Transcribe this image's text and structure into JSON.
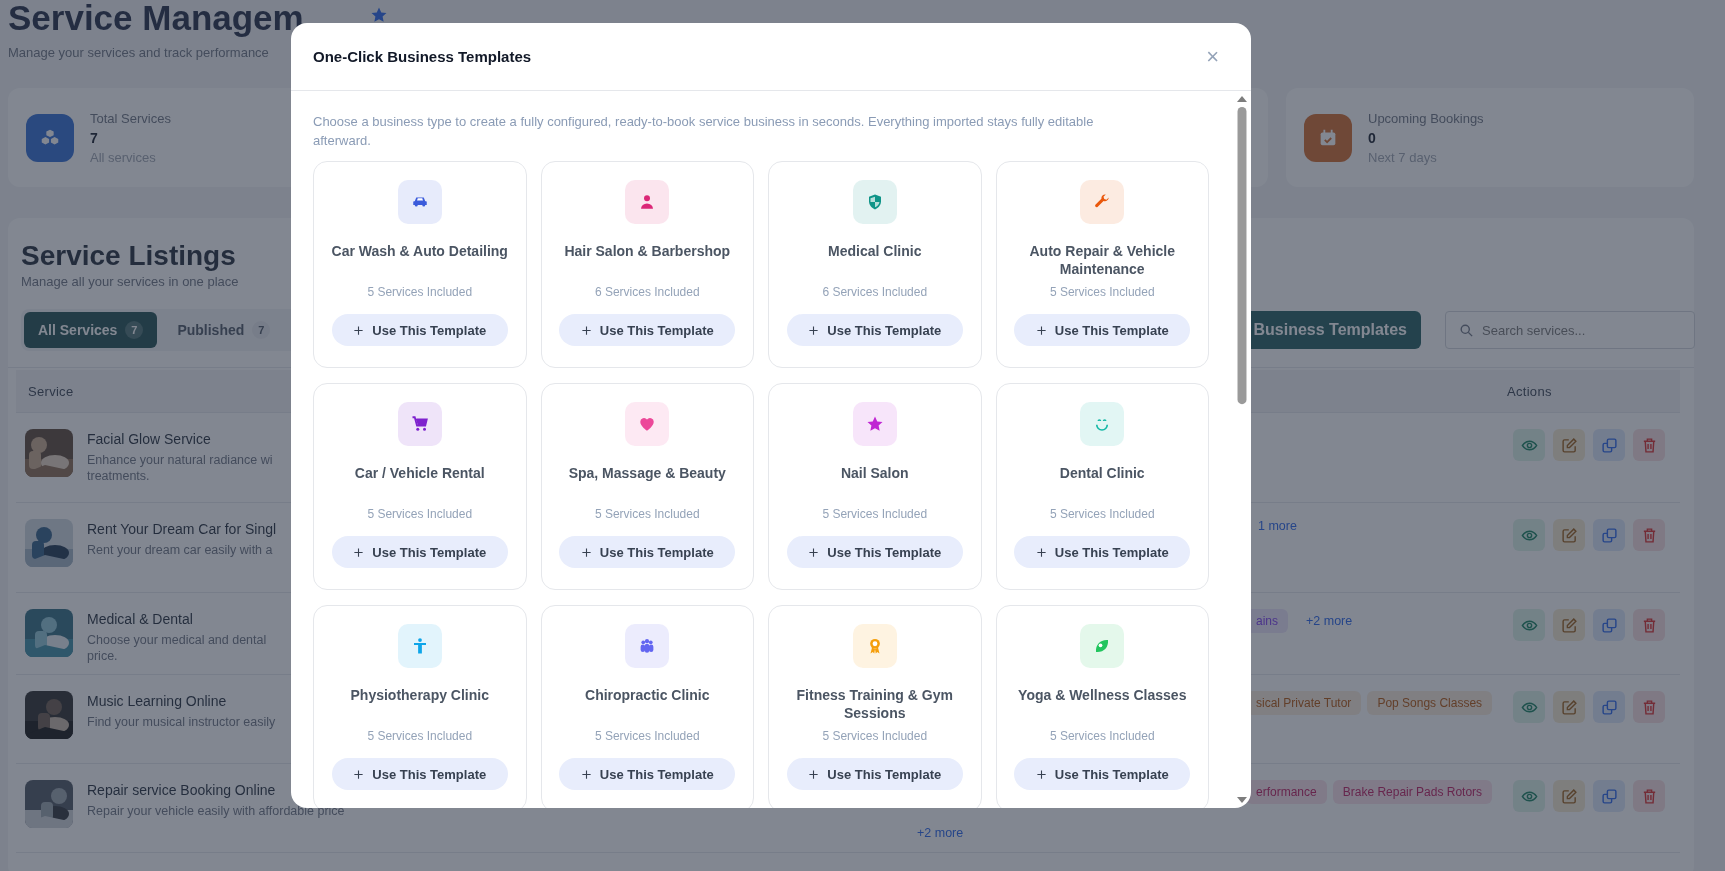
{
  "page": {
    "title": "Service Managem",
    "subtitle": "Manage your services and track performance"
  },
  "stats": [
    {
      "label": "Total Services",
      "value": "7",
      "note": "All services",
      "kind": "boxes"
    },
    {
      "kind": "blank"
    },
    {
      "label": "Upcoming Bookings",
      "value": "0",
      "note": "Next 7 days",
      "kind": "calendar"
    }
  ],
  "listings": {
    "title": "Service Listings",
    "subtitle": "Manage all your services in one place",
    "tabs": [
      {
        "label": "All Services",
        "count": "7",
        "selected": true
      },
      {
        "label": "Published",
        "count": "7",
        "selected": false
      }
    ],
    "templates_button": "Business Templates",
    "search": {
      "placeholder": "Search services..."
    },
    "columns": [
      "Service",
      "Actions"
    ],
    "rows": [
      {
        "title": "Facial Glow Service",
        "description": [
          "Enhance your natural radiance wi",
          "treatments."
        ]
      },
      {
        "title": "Rent Your Dream Car for Singl",
        "description": [
          "Rent your dream car easily with a"
        ],
        "more": "1 more"
      },
      {
        "title": "Medical & Dental",
        "description": [
          "Choose your medical and dental",
          "price."
        ],
        "tags": [
          "ains"
        ],
        "more": "+2 more"
      },
      {
        "title": "Music Learning Online",
        "description": [
          "Find your musical instructor easily"
        ],
        "tags": [
          "sical Private Tutor",
          "Pop Songs Classes"
        ]
      },
      {
        "title": "Repair service Booking Online",
        "description": [
          "Repair your vehicle easily with affordable price"
        ],
        "tags": [
          "erformance",
          "Brake Repair Pads Rotors"
        ],
        "more_line": "+2 more"
      }
    ]
  },
  "modal": {
    "title": "One-Click Business Templates",
    "close": "×",
    "description": "Choose a business type to create a fully configured, ready-to-book service business in seconds. Everything imported stays fully editable afterward.",
    "templates": [
      {
        "name": "Car Wash & Auto Detailing",
        "count": "5 Services Included",
        "button": "Use This Template",
        "kind": "car",
        "color": "#3b5bdb"
      },
      {
        "name": "Hair Salon & Barbershop",
        "count": "6 Services Included",
        "button": "Use This Template",
        "kind": "person",
        "color": "#db2777"
      },
      {
        "name": "Medical Clinic",
        "count": "6 Services Included",
        "button": "Use This Template",
        "kind": "shield",
        "color": "#0f9488"
      },
      {
        "name": "Auto Repair & Vehicle Maintenance",
        "count": "5 Services Included",
        "button": "Use This Template",
        "kind": "wrench",
        "color": "#ea580c"
      },
      {
        "name": "Car / Vehicle Rental",
        "count": "5 Services Included",
        "button": "Use This Template",
        "kind": "cart",
        "color": "#7e22ce"
      },
      {
        "name": "Spa, Massage & Beauty",
        "count": "5 Services Included",
        "button": "Use This Template",
        "kind": "heart",
        "color": "#ec4899"
      },
      {
        "name": "Nail Salon",
        "count": "5 Services Included",
        "button": "Use This Template",
        "kind": "star",
        "color": "#c026d3"
      },
      {
        "name": "Dental Clinic",
        "count": "5 Services Included",
        "button": "Use This Template",
        "kind": "smile",
        "color": "#14b8a6"
      },
      {
        "name": "Physiotherapy Clinic",
        "count": "5 Services Included",
        "button": "Use This Template",
        "kind": "figure",
        "color": "#0ea5e9"
      },
      {
        "name": "Chiropractic Clinic",
        "count": "5 Services Included",
        "button": "Use This Template",
        "kind": "group",
        "color": "#6366f1"
      },
      {
        "name": "Fitness Training & Gym Sessions",
        "count": "5 Services Included",
        "button": "Use This Template",
        "kind": "award",
        "color": "#f59e0b"
      },
      {
        "name": "Yoga & Wellness Classes",
        "count": "5 Services Included",
        "button": "Use This Template",
        "kind": "leaf",
        "color": "#22c55e"
      }
    ]
  }
}
